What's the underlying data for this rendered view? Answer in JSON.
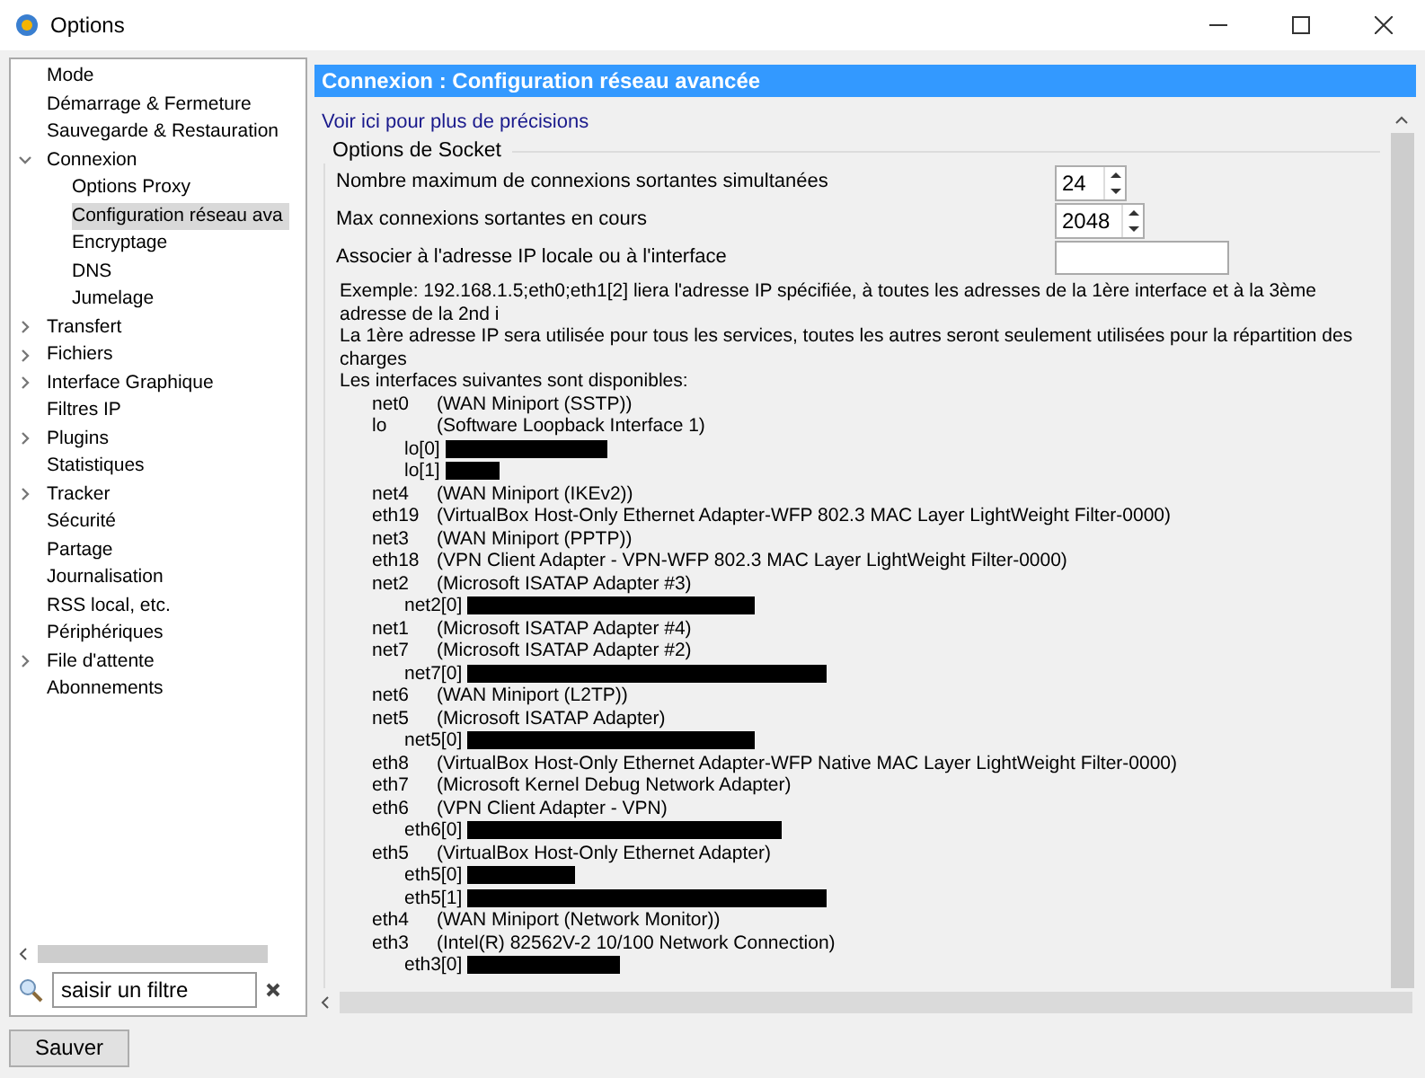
{
  "window": {
    "title": "Options"
  },
  "sidebar": {
    "items": [
      {
        "label": "Mode",
        "selected": false
      },
      {
        "label": "Démarrage & Fermeture",
        "selected": false
      },
      {
        "label": "Sauvegarde & Restauration",
        "selected": false
      },
      {
        "label": "Connexion",
        "selected": false,
        "expanded": true,
        "children": [
          {
            "label": "Options Proxy",
            "selected": false
          },
          {
            "label": "Configuration réseau ava",
            "selected": true
          },
          {
            "label": "Encryptage",
            "selected": false
          },
          {
            "label": "DNS",
            "selected": false
          },
          {
            "label": "Jumelage",
            "selected": false
          }
        ]
      },
      {
        "label": "Transfert",
        "selected": false,
        "expanded": false
      },
      {
        "label": "Fichiers",
        "selected": false,
        "expanded": false
      },
      {
        "label": "Interface Graphique",
        "selected": false,
        "expanded": false
      },
      {
        "label": "Filtres IP",
        "selected": false
      },
      {
        "label": "Plugins",
        "selected": false,
        "expanded": false
      },
      {
        "label": "Statistiques",
        "selected": false
      },
      {
        "label": "Tracker",
        "selected": false,
        "expanded": false
      },
      {
        "label": "Sécurité",
        "selected": false
      },
      {
        "label": "Partage",
        "selected": false
      },
      {
        "label": "Journalisation",
        "selected": false
      },
      {
        "label": "RSS local, etc.",
        "selected": false
      },
      {
        "label": "Périphériques",
        "selected": false
      },
      {
        "label": "File d'attente",
        "selected": false,
        "expanded": false
      },
      {
        "label": "Abonnements",
        "selected": false
      }
    ],
    "filter": {
      "placeholder": "saisir un filtre"
    }
  },
  "save_button": "Sauver",
  "panel": {
    "header": "Connexion : Configuration réseau avancée",
    "link": "Voir ici pour plus de précisions",
    "group": "Options de Socket",
    "settings": [
      {
        "kind": "spin",
        "label": "Nombre maximum de connexions sortantes simultanées",
        "value": "24"
      },
      {
        "kind": "spin",
        "label": "Max connexions sortantes en cours",
        "value": "2048"
      },
      {
        "kind": "text",
        "label": "Associer à l'adresse IP locale ou à l'interface"
      }
    ],
    "help_lines": [
      "Exemple: 192.168.1.5;eth0;eth1[2] liera l'adresse IP spécifiée, à toutes les adresses de la 1ère interface et à la 3ème adresse de la 2nd i",
      "La 1ère adresse IP sera utilisée pour tous les services, toutes les autres seront seulement utilisées pour la répartition des charges",
      "Les interfaces suivantes sont disponibles:"
    ],
    "interfaces": [
      {
        "name": "net0",
        "description": "(WAN Miniport (SSTP))"
      },
      {
        "name": "lo",
        "description": "(Software Loopback Interface 1)",
        "addresses": [
          "lo[0]",
          "lo[1]"
        ]
      },
      {
        "name": "net4",
        "description": "(WAN Miniport (IKEv2))"
      },
      {
        "name": "eth19",
        "description": "(VirtualBox Host-Only Ethernet Adapter-WFP 802.3 MAC Layer LightWeight Filter-0000)"
      },
      {
        "name": "net3",
        "description": "(WAN Miniport (PPTP))"
      },
      {
        "name": "eth18",
        "description": "(VPN Client Adapter - VPN-WFP 802.3 MAC Layer LightWeight Filter-0000)"
      },
      {
        "name": "net2",
        "description": "(Microsoft ISATAP Adapter #3)",
        "addresses": [
          "net2[0]"
        ]
      },
      {
        "name": "net1",
        "description": "(Microsoft ISATAP Adapter #4)"
      },
      {
        "name": "net7",
        "description": "(Microsoft ISATAP Adapter #2)",
        "addresses": [
          "net7[0]"
        ]
      },
      {
        "name": "net6",
        "description": "(WAN Miniport (L2TP))"
      },
      {
        "name": "net5",
        "description": "(Microsoft ISATAP Adapter)",
        "addresses": [
          "net5[0]"
        ]
      },
      {
        "name": "eth8",
        "description": "(VirtualBox Host-Only Ethernet Adapter-WFP Native MAC Layer LightWeight Filter-0000)"
      },
      {
        "name": "eth7",
        "description": "(Microsoft Kernel Debug Network Adapter)"
      },
      {
        "name": "eth6",
        "description": "(VPN Client Adapter - VPN)",
        "addresses": [
          "eth6[0]"
        ]
      },
      {
        "name": "eth5",
        "description": "(VirtualBox Host-Only Ethernet Adapter)",
        "addresses": [
          "eth5[0]",
          "eth5[1]"
        ]
      },
      {
        "name": "eth4",
        "description": "(WAN Miniport (Network Monitor))"
      },
      {
        "name": "eth3",
        "description": "(Intel(R) 82562V-2 10/100 Network Connection)",
        "addresses": [
          "eth3[0]"
        ]
      }
    ]
  }
}
